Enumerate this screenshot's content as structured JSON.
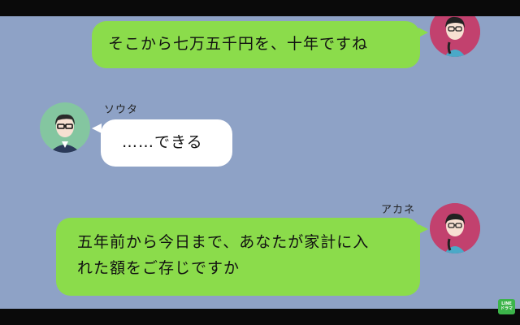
{
  "messages": [
    {
      "sender": "me",
      "text": "そこから七万五千円を、十年ですね"
    },
    {
      "sender": "them",
      "name": "ソウタ",
      "text": "……できる"
    },
    {
      "sender": "me",
      "name": "アカネ",
      "text_line1": "五年前から今日まで、あなたが家計に入",
      "text_line2": "れた額をご存じですか"
    }
  ],
  "avatars": {
    "akane": "woman-avatar",
    "souta": "man-avatar"
  },
  "colors": {
    "chat_background": "#8ea2c6",
    "my_bubble": "#8bdc4b",
    "their_bubble": "#ffffff",
    "akane_avatar_bg": "#c2416e",
    "souta_avatar_bg": "#84c6a0"
  },
  "watermark": {
    "line1": "LINE",
    "line2": "ドラマ"
  }
}
